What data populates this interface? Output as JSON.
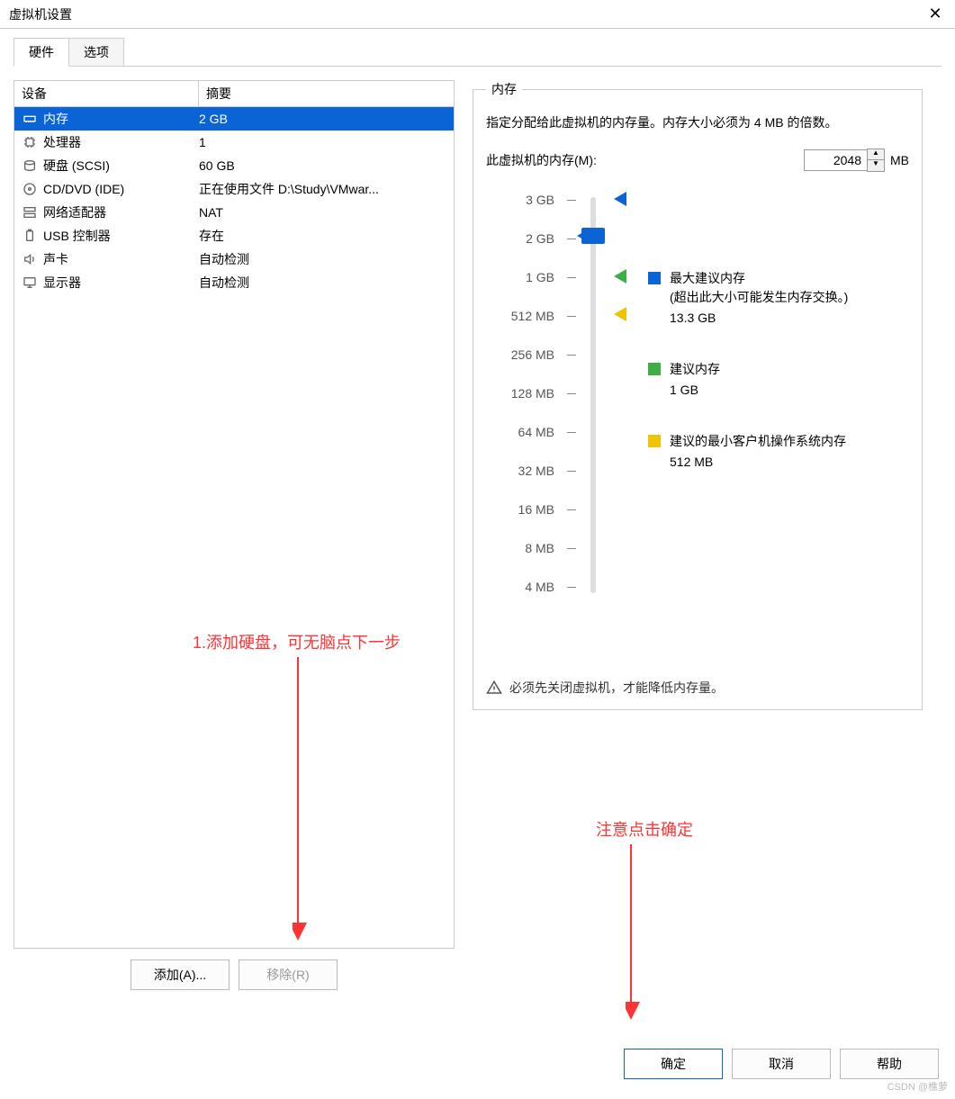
{
  "window": {
    "title": "虚拟机设置",
    "close": "✕"
  },
  "tabs": {
    "hardware": "硬件",
    "options": "选项"
  },
  "columns": {
    "device": "设备",
    "summary": "摘要"
  },
  "hw": [
    {
      "name": "内存",
      "summary": "2 GB",
      "icon": "memory",
      "sel": true
    },
    {
      "name": "处理器",
      "summary": "1",
      "icon": "cpu",
      "sel": false
    },
    {
      "name": "硬盘 (SCSI)",
      "summary": "60 GB",
      "icon": "disk",
      "sel": false
    },
    {
      "name": "CD/DVD (IDE)",
      "summary": "正在使用文件 D:\\Study\\VMwar...",
      "icon": "cd",
      "sel": false
    },
    {
      "name": "网络适配器",
      "summary": "NAT",
      "icon": "net",
      "sel": false
    },
    {
      "name": "USB 控制器",
      "summary": "存在",
      "icon": "usb",
      "sel": false
    },
    {
      "name": "声卡",
      "summary": "自动检测",
      "icon": "sound",
      "sel": false
    },
    {
      "name": "显示器",
      "summary": "自动检测",
      "icon": "display",
      "sel": false
    }
  ],
  "buttons": {
    "add": "添加(A)...",
    "remove": "移除(R)",
    "ok": "确定",
    "cancel": "取消",
    "help": "帮助"
  },
  "memory": {
    "legend": "内存",
    "desc": "指定分配给此虚拟机的内存量。内存大小必须为 4 MB 的倍数。",
    "field_label": "此虚拟机的内存(M):",
    "value": "2048",
    "unit": "MB",
    "ticks": [
      "3 GB",
      "2 GB",
      "1 GB",
      "512 MB",
      "256 MB",
      "128 MB",
      "64 MB",
      "32 MB",
      "16 MB",
      "8 MB",
      "4 MB"
    ],
    "leg_max": "最大建议内存",
    "leg_max_note": "(超出此大小可能发生内存交换。)",
    "leg_max_val": "13.3 GB",
    "leg_rec": "建议内存",
    "leg_rec_val": "1 GB",
    "leg_min": "建议的最小客户机操作系统内存",
    "leg_min_val": "512 MB",
    "warn": "必须先关闭虚拟机，才能降低内存量。"
  },
  "annot": {
    "a1": "1.添加硬盘，可无脑点下一步",
    "a2": "注意点击确定"
  },
  "watermark": "CSDN @樵萝"
}
